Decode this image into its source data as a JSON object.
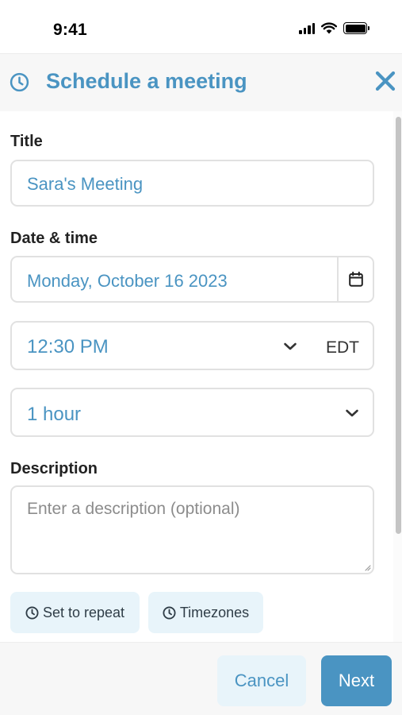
{
  "status_bar": {
    "time": "9:41"
  },
  "header": {
    "title": "Schedule a meeting",
    "icon": "clock-icon",
    "close_icon": "close-icon"
  },
  "form": {
    "title_label": "Title",
    "title_value": "Sara's Meeting",
    "datetime_label": "Date & time",
    "date_value": "Monday, October 16 2023",
    "time_value": "12:30 PM",
    "timezone": "EDT",
    "duration_value": "1 hour",
    "description_label": "Description",
    "description_placeholder": "Enter a description (optional)"
  },
  "chips": {
    "repeat": "Set to repeat",
    "timezones": "Timezones"
  },
  "footer": {
    "cancel": "Cancel",
    "next": "Next"
  },
  "colors": {
    "accent": "#4a94c2",
    "chip_bg": "#e8f4fa",
    "border": "#e1e1e1"
  }
}
